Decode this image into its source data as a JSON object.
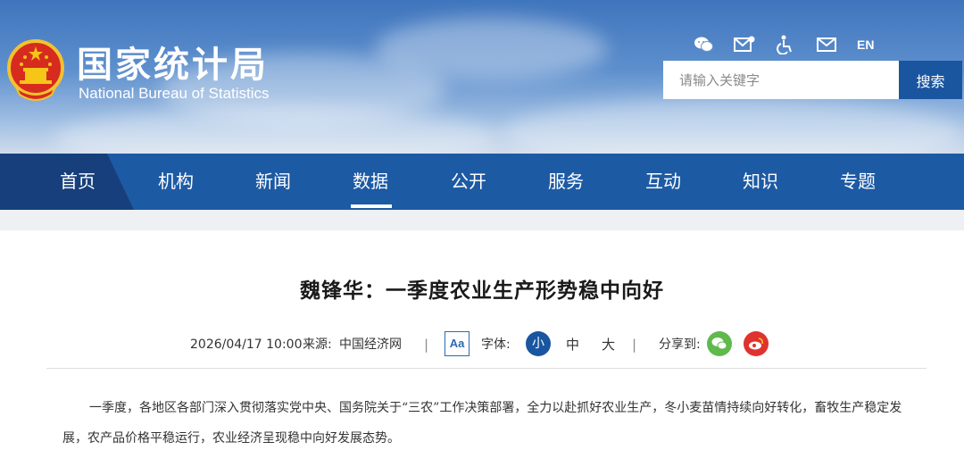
{
  "header": {
    "title_cn": "国家统计局",
    "title_en": "National Bureau of Statistics",
    "icons": [
      "wechat-icon",
      "mail-edit-icon",
      "accessibility-icon",
      "mail-icon"
    ],
    "lang_label": "EN",
    "search_placeholder": "请输入关键字",
    "search_button": "搜索"
  },
  "nav": {
    "items": [
      "首页",
      "机构",
      "新闻",
      "数据",
      "公开",
      "服务",
      "互动",
      "知识",
      "专题"
    ],
    "active": "数据"
  },
  "article": {
    "title": "魏锋华：一季度农业生产形势稳中向好",
    "datetime": "2026/04/17 10:00",
    "source_label": "来源:",
    "source": "中国经济网",
    "font_toggle": "Aa",
    "font_label": "字体:",
    "size_small": "小",
    "size_medium": "中",
    "size_large": "大",
    "share_label": "分享到:",
    "share_icons": [
      "wechat-share-icon",
      "weibo-share-icon"
    ],
    "body": "一季度，各地区各部门深入贯彻落实党中央、国务院关于“三农”工作决策部署，全力以赴抓好农业生产，冬小麦苗情持续向好转化，畜牧生产稳定发展，农产品价格平稳运行，农业经济呈现稳中向好发展态势。"
  },
  "colors": {
    "nav_bg": "#1d5aa4",
    "accent": "#1a55a0",
    "wechat_green": "#5fb94b",
    "weibo_red": "#e0322f"
  }
}
